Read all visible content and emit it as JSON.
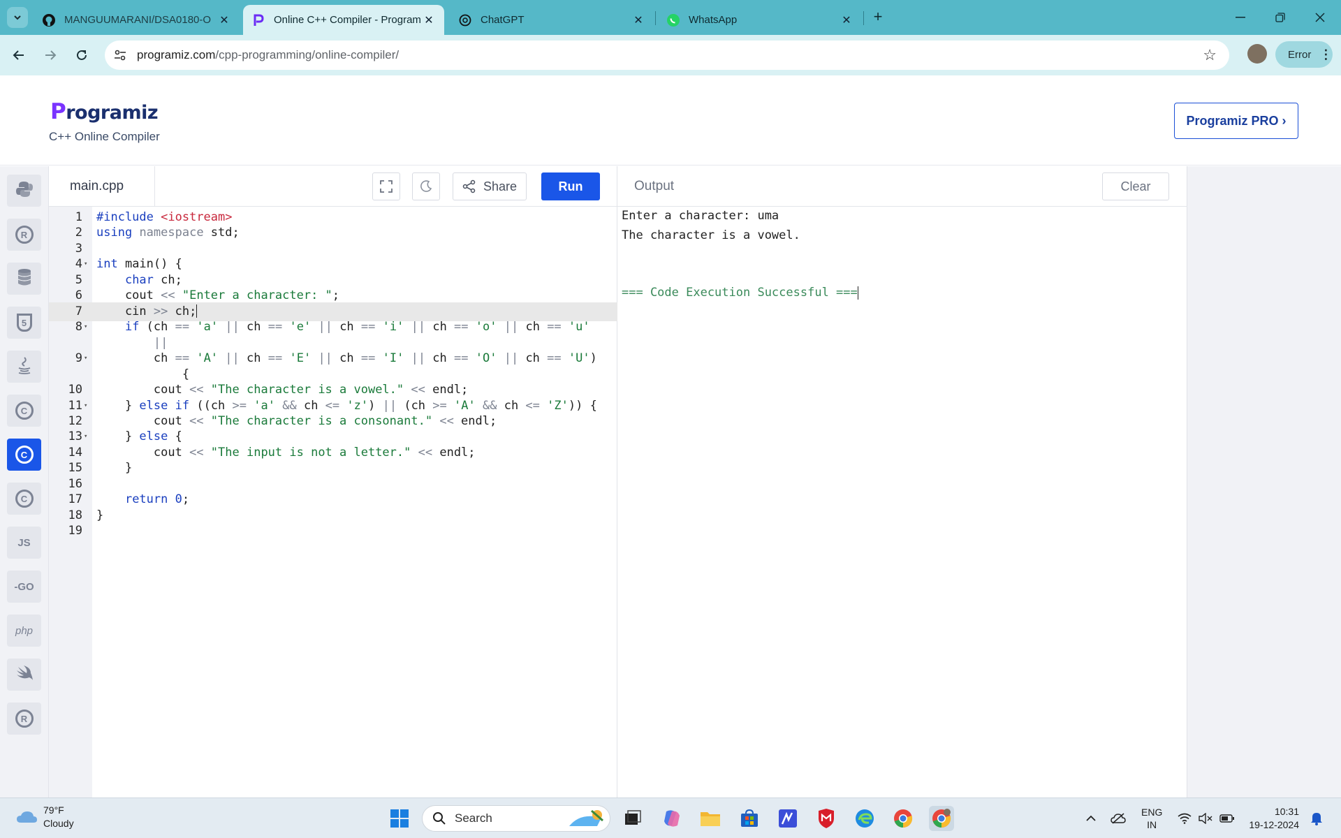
{
  "browser": {
    "tabs": [
      {
        "title": "MANGUUMARANI/DSA0180-O",
        "icon": "github-icon",
        "active": false
      },
      {
        "title": "Online C++ Compiler - Program",
        "icon": "programiz-icon",
        "active": true
      },
      {
        "title": "ChatGPT",
        "icon": "chatgpt-icon",
        "active": false
      },
      {
        "title": "WhatsApp",
        "icon": "whatsapp-icon",
        "active": false
      }
    ],
    "url_host": "programiz.com",
    "url_path": "/cpp-programming/online-compiler/",
    "profile_status": "Error"
  },
  "header": {
    "logo": "rogramiz",
    "logo_first": "P",
    "subtitle": "C++ Online Compiler",
    "pro_button": "Programiz PRO ›"
  },
  "sidebar": {
    "languages": [
      {
        "name": "python-icon",
        "label": "",
        "active": false
      },
      {
        "name": "r-icon",
        "label": "R",
        "active": false
      },
      {
        "name": "sql-icon",
        "label": "",
        "active": false
      },
      {
        "name": "html-icon",
        "label": "5",
        "active": false
      },
      {
        "name": "java-icon",
        "label": "",
        "active": false
      },
      {
        "name": "c-icon",
        "label": "C",
        "active": false
      },
      {
        "name": "cpp-icon",
        "label": "C",
        "active": true
      },
      {
        "name": "csharp-icon",
        "label": "C",
        "active": false
      },
      {
        "name": "js-icon",
        "label": "JS",
        "active": false
      },
      {
        "name": "go-icon",
        "label": "-GO",
        "active": false
      },
      {
        "name": "php-icon",
        "label": "php",
        "active": false
      },
      {
        "name": "swift-icon",
        "label": "",
        "active": false
      },
      {
        "name": "rust-icon",
        "label": "R",
        "active": false
      }
    ]
  },
  "editor": {
    "filename": "main.cpp",
    "share_label": "Share",
    "run_label": "Run",
    "active_line": 7,
    "lines": [
      {
        "n": "1",
        "fold": false,
        "code": "#include <iostream>"
      },
      {
        "n": "2",
        "fold": false,
        "code": "using namespace std;"
      },
      {
        "n": "3",
        "fold": false,
        "code": ""
      },
      {
        "n": "4",
        "fold": true,
        "code": "int main() {"
      },
      {
        "n": "5",
        "fold": false,
        "code": "    char ch;"
      },
      {
        "n": "6",
        "fold": false,
        "code": "    cout << \"Enter a character: \";"
      },
      {
        "n": "7",
        "fold": false,
        "code": "    cin >> ch;"
      },
      {
        "n": "8",
        "fold": true,
        "code": "    if (ch == 'a' || ch == 'e' || ch == 'i' || ch == 'o' || ch == 'u'"
      },
      {
        "n": "",
        "fold": false,
        "code": "        ||"
      },
      {
        "n": "9",
        "fold": true,
        "code": "        ch == 'A' || ch == 'E' || ch == 'I' || ch == 'O' || ch == 'U')"
      },
      {
        "n": "",
        "fold": false,
        "code": "            {"
      },
      {
        "n": "10",
        "fold": false,
        "code": "        cout << \"The character is a vowel.\" << endl;"
      },
      {
        "n": "11",
        "fold": true,
        "code": "    } else if ((ch >= 'a' && ch <= 'z') || (ch >= 'A' && ch <= 'Z')) {"
      },
      {
        "n": "12",
        "fold": false,
        "code": "        cout << \"The character is a consonant.\" << endl;"
      },
      {
        "n": "13",
        "fold": true,
        "code": "    } else {"
      },
      {
        "n": "14",
        "fold": false,
        "code": "        cout << \"The input is not a letter.\" << endl;"
      },
      {
        "n": "15",
        "fold": false,
        "code": "    }"
      },
      {
        "n": "16",
        "fold": false,
        "code": ""
      },
      {
        "n": "17",
        "fold": false,
        "code": "    return 0;"
      },
      {
        "n": "18",
        "fold": false,
        "code": "}"
      },
      {
        "n": "19",
        "fold": false,
        "code": ""
      }
    ]
  },
  "output": {
    "title": "Output",
    "clear_label": "Clear",
    "lines": [
      "Enter a character: uma",
      "The character is a vowel.",
      "",
      "",
      "=== Code Execution Successful ==="
    ]
  },
  "taskbar": {
    "temperature": "79°F",
    "weather": "Cloudy",
    "search_label": "Search",
    "language_top": "ENG",
    "language_bottom": "IN",
    "time": "10:31",
    "date": "19-12-2024"
  }
}
